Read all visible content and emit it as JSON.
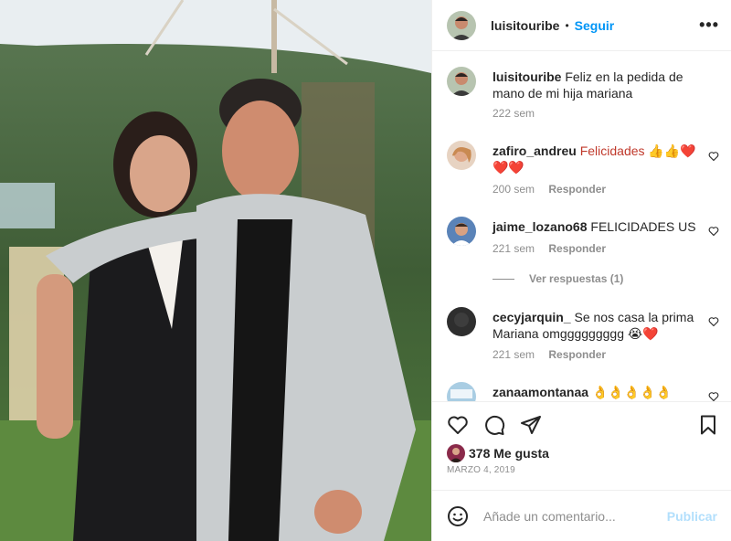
{
  "post": {
    "username": "luisitouribe",
    "separator": "•",
    "follow_label": "Seguir",
    "more_label": "•••"
  },
  "caption": {
    "username": "luisitouribe",
    "text": "Feliz en la pedida de mano de mi hija mariana",
    "time": "222 sem"
  },
  "comments": [
    {
      "username": "zafiro_andreu",
      "text": "Felicidades 👍👍❤️ ❤️❤️",
      "time": "200 sem",
      "reply_label": "Responder"
    },
    {
      "username": "jaime_lozano68",
      "text": "FELICIDADES US",
      "time": "221 sem",
      "reply_label": "Responder",
      "view_replies": "Ver respuestas (1)"
    },
    {
      "username": "cecyjarquin_",
      "text": "Se nos casa la prima Mariana omggggggggg 😭❤️",
      "time": "221 sem",
      "reply_label": "Responder"
    },
    {
      "username": "zanaamontanaa",
      "text": "👌👌👌👌👌"
    }
  ],
  "stats": {
    "likes": "378 Me gusta",
    "date": "MARZO 4, 2019"
  },
  "composer": {
    "placeholder": "Añade un comentario...",
    "publish_label": "Publicar"
  },
  "icons": [
    "heart-icon",
    "comment-icon",
    "share-icon",
    "bookmark-icon",
    "emoji-icon",
    "more-icon"
  ],
  "colors": {
    "link": "#0095f6",
    "publish_disabled": "#b2dffc",
    "muted": "#8e8e8e",
    "text": "#262626"
  }
}
